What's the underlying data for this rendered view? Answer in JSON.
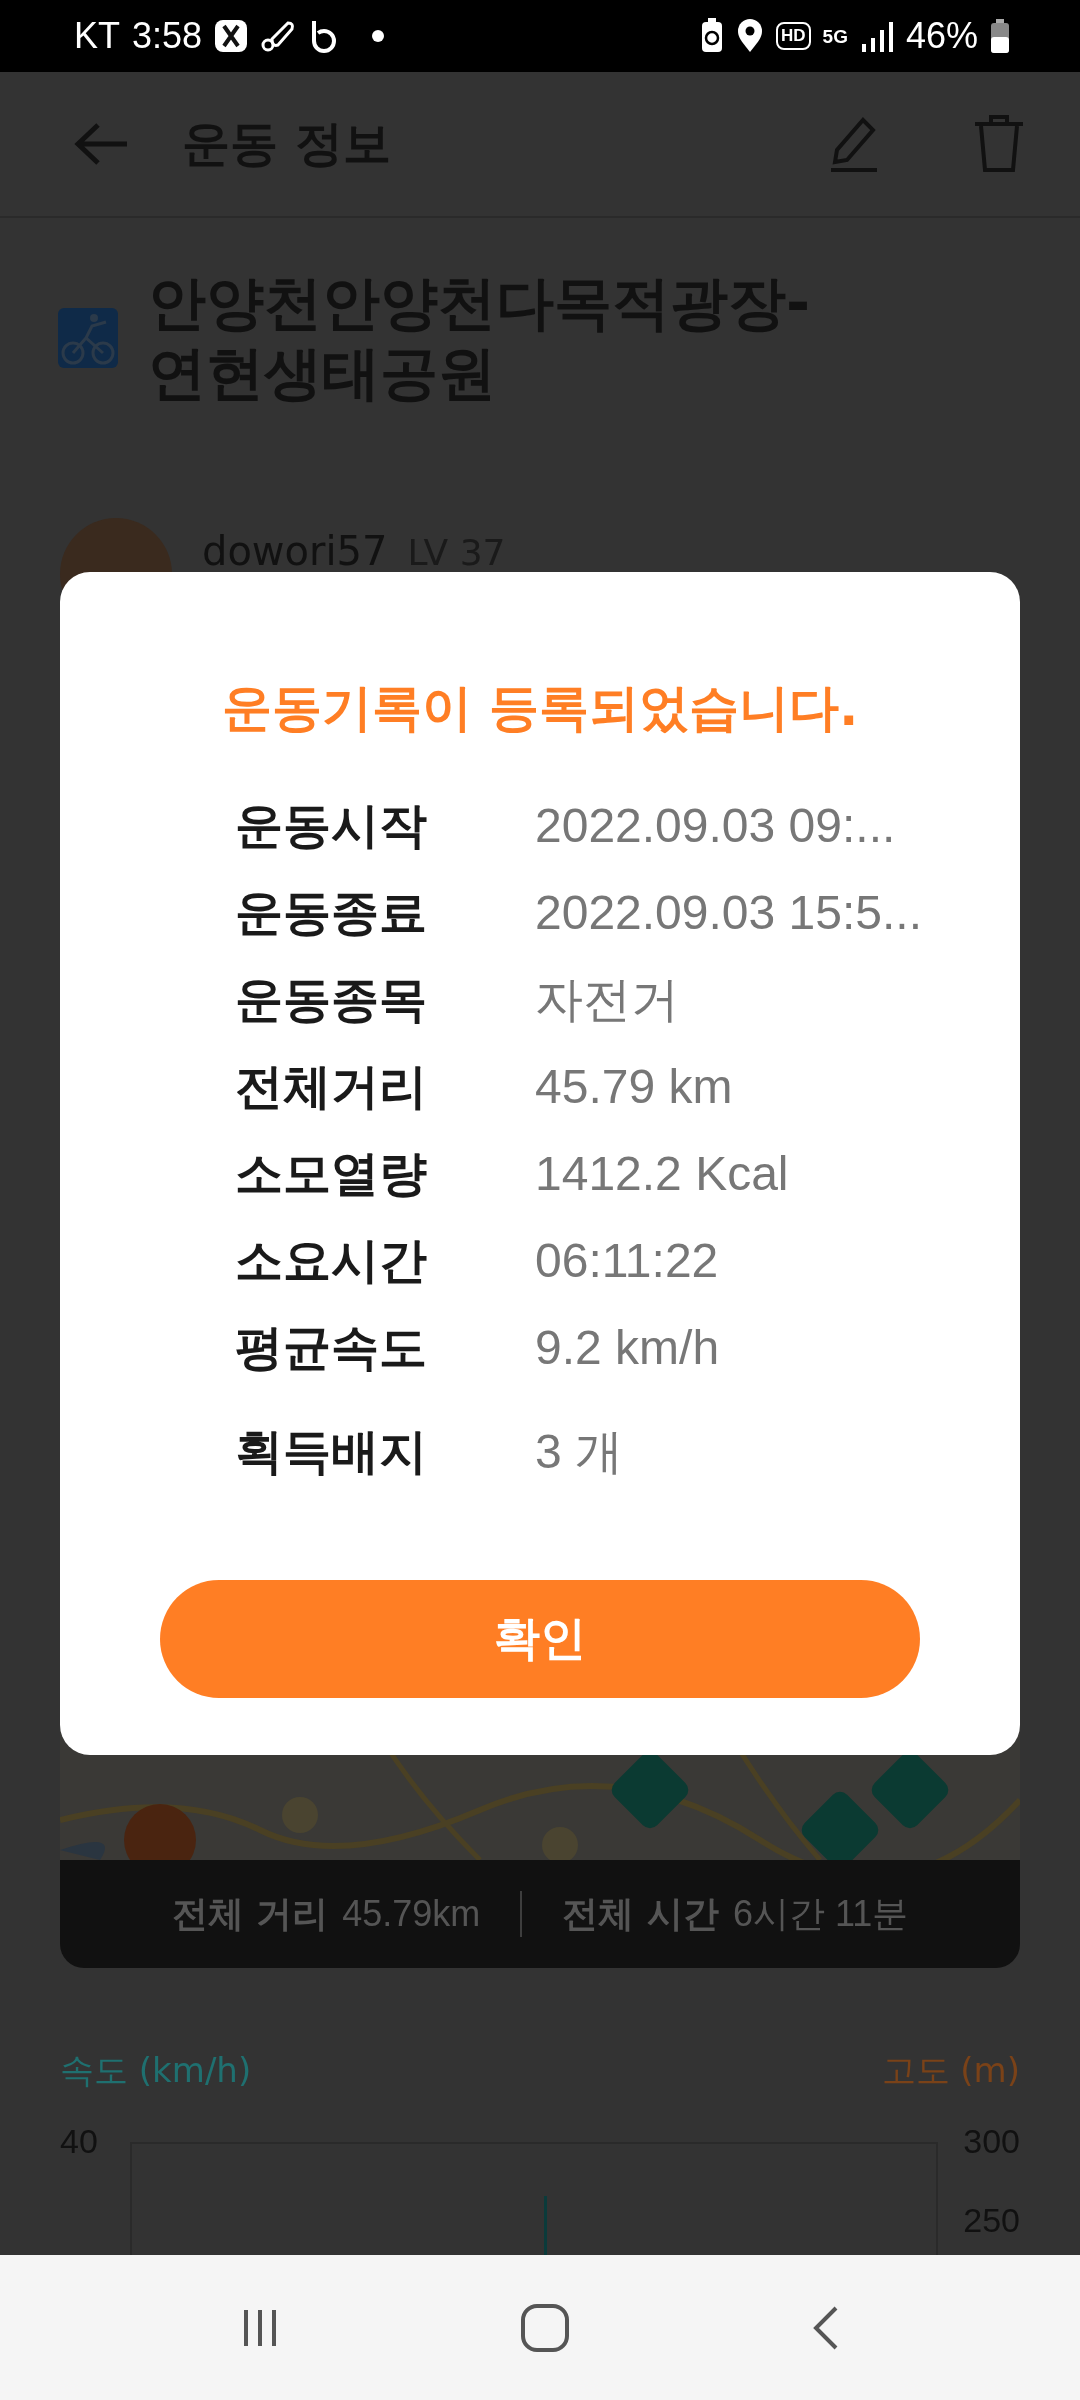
{
  "status_bar": {
    "carrier": "KT",
    "time": "3:58",
    "hd": "HD",
    "network": "5G",
    "battery": "46%"
  },
  "header": {
    "title": "운동 정보"
  },
  "activity": {
    "title_lines": [
      "안양천안양천다목적광장-",
      "연현생태공원"
    ]
  },
  "user": {
    "name": "dowori57",
    "level": "LV 37"
  },
  "dialog": {
    "title": "운동기록이 등록되었습니다.",
    "rows": [
      {
        "label": "운동시작",
        "value": "2022.09.03 09:..."
      },
      {
        "label": "운동종료",
        "value": "2022.09.03 15:5..."
      },
      {
        "label": "운동종목",
        "value": "자전거"
      },
      {
        "label": "전체거리",
        "value": "45.79 km"
      },
      {
        "label": "소모열량",
        "value": "1412.2 Kcal"
      },
      {
        "label": "소요시간",
        "value": "06:11:22"
      },
      {
        "label": "평균속도",
        "value": "9.2 km/h"
      },
      {
        "label": "획득배지",
        "value": "3 개"
      }
    ],
    "confirm": "확인"
  },
  "summary": {
    "distance_label": "전체 거리",
    "distance": "45.79km",
    "time_label": "전체 시간",
    "time": "6시간 11분"
  },
  "chart": {
    "left_label": "속도 (km/h)",
    "right_label": "고도 (m)",
    "left_ticks": [
      "40"
    ],
    "right_ticks": [
      "300",
      "250"
    ]
  }
}
